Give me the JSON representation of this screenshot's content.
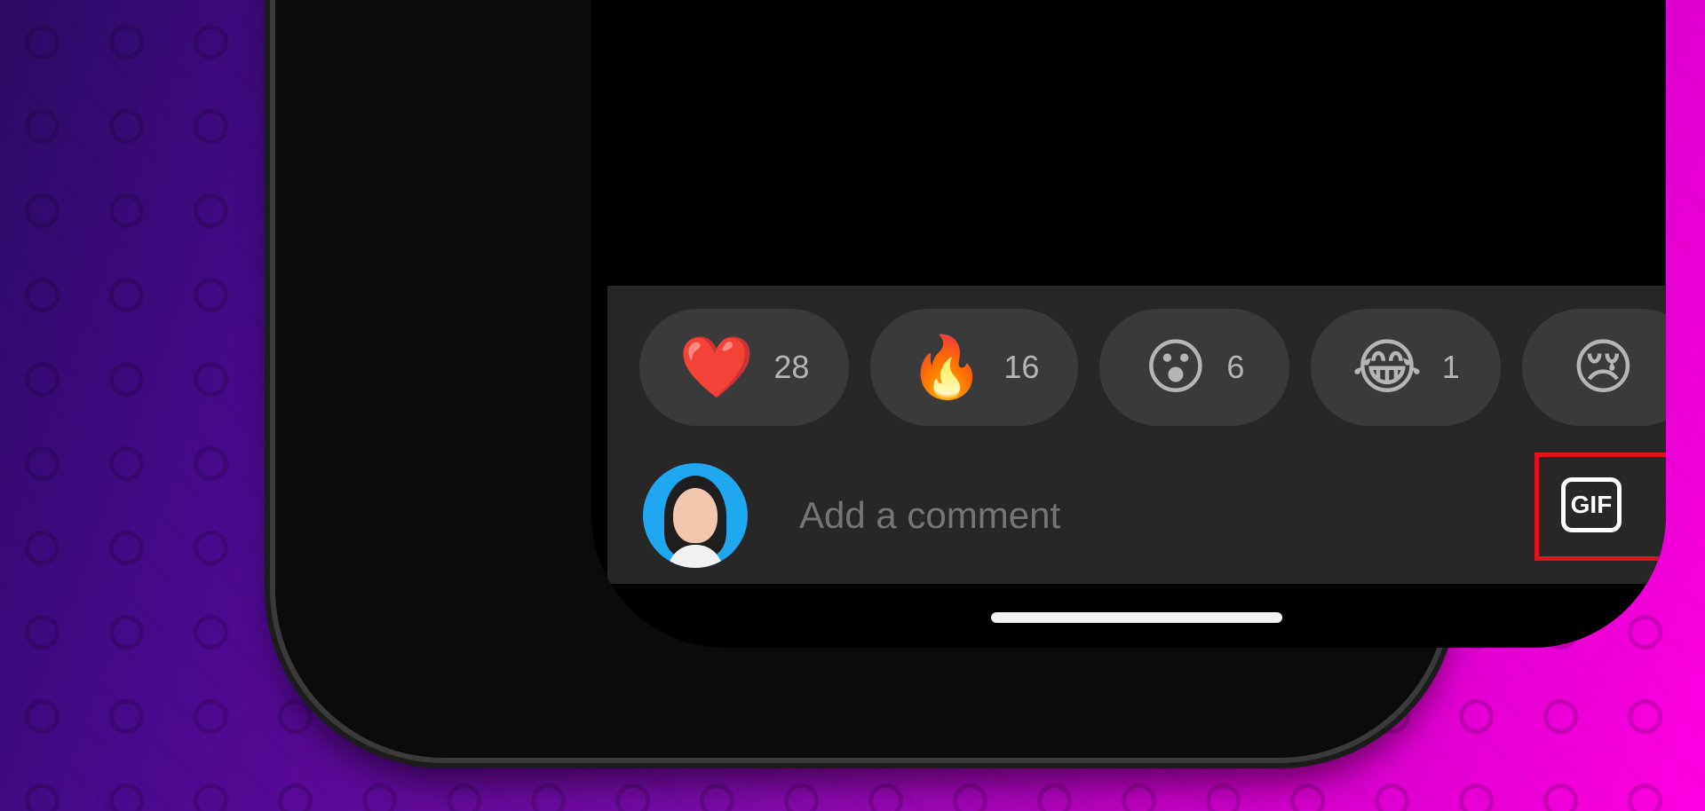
{
  "reactions": [
    {
      "emoji": "❤️",
      "count": "28"
    },
    {
      "emoji": "🔥",
      "count": "16"
    },
    {
      "emoji": "😮",
      "count": "6"
    },
    {
      "emoji": "😂",
      "count": "1"
    },
    {
      "emoji": "😢",
      "count": ""
    }
  ],
  "comment": {
    "placeholder": "Add a comment",
    "gif_label": "GIF"
  },
  "colors": {
    "panel": "#272727",
    "pill": "#3a3a3a",
    "highlight": "#e0121a",
    "avatar_bg": "#1fa8ef"
  }
}
